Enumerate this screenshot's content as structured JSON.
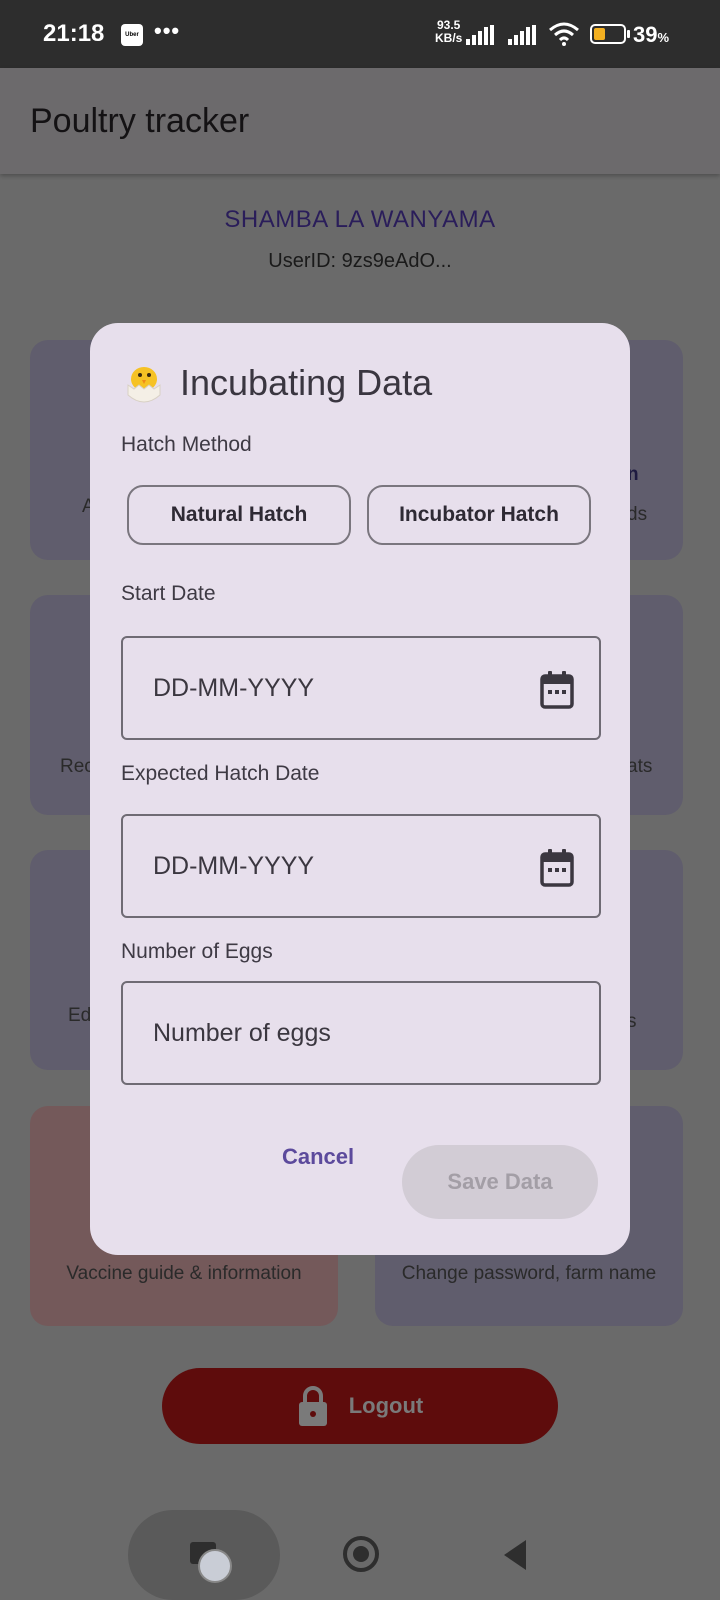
{
  "status_bar": {
    "time": "21:18",
    "notification_app": "Uber",
    "more": "•••",
    "net_speed_value": "93.5",
    "net_speed_unit": "KB/s",
    "battery_percent": "39",
    "battery_suffix": "%",
    "battery_level": 0.39
  },
  "app_bar": {
    "title": "Poultry tracker"
  },
  "profile": {
    "farm_name": "SHAMBA LA WANYAMA",
    "user_id": "UserID: 9zs9eAdO..."
  },
  "background_cards": {
    "c1_left_fragment": "A",
    "c2_right_bold_fragment": "n",
    "c2_right_fragment": "ds",
    "c3_left_fragment": "Rec",
    "c4_right_fragment": "ats",
    "c5_left_fragment": "Ed",
    "c6_right_fragment": "s",
    "c7_text": "Vaccine guide & information",
    "c8_text": "Change password, farm name"
  },
  "logout": {
    "label": "Logout"
  },
  "dialog": {
    "title": "Incubating Data",
    "hatch_method_label": "Hatch Method",
    "natural_hatch": "Natural Hatch",
    "incubator_hatch": "Incubator Hatch",
    "start_date_label": "Start Date",
    "start_date_placeholder": "DD-MM-YYYY",
    "expected_hatch_label": "Expected Hatch Date",
    "expected_hatch_placeholder": "DD-MM-YYYY",
    "eggs_label": "Number of Eggs",
    "eggs_placeholder": "Number of eggs",
    "cancel": "Cancel",
    "save": "Save Data"
  },
  "colors": {
    "accent": "#5c4a9c",
    "dialog_bg": "#e7dfec",
    "logout_bg": "#5e0c0c",
    "battery": "#f3b021"
  },
  "icons": [
    "chick-icon",
    "calendar-icon",
    "lock-icon",
    "wifi-icon",
    "signal-icon",
    "battery-icon",
    "home-icon",
    "back-icon",
    "recents-icon"
  ]
}
